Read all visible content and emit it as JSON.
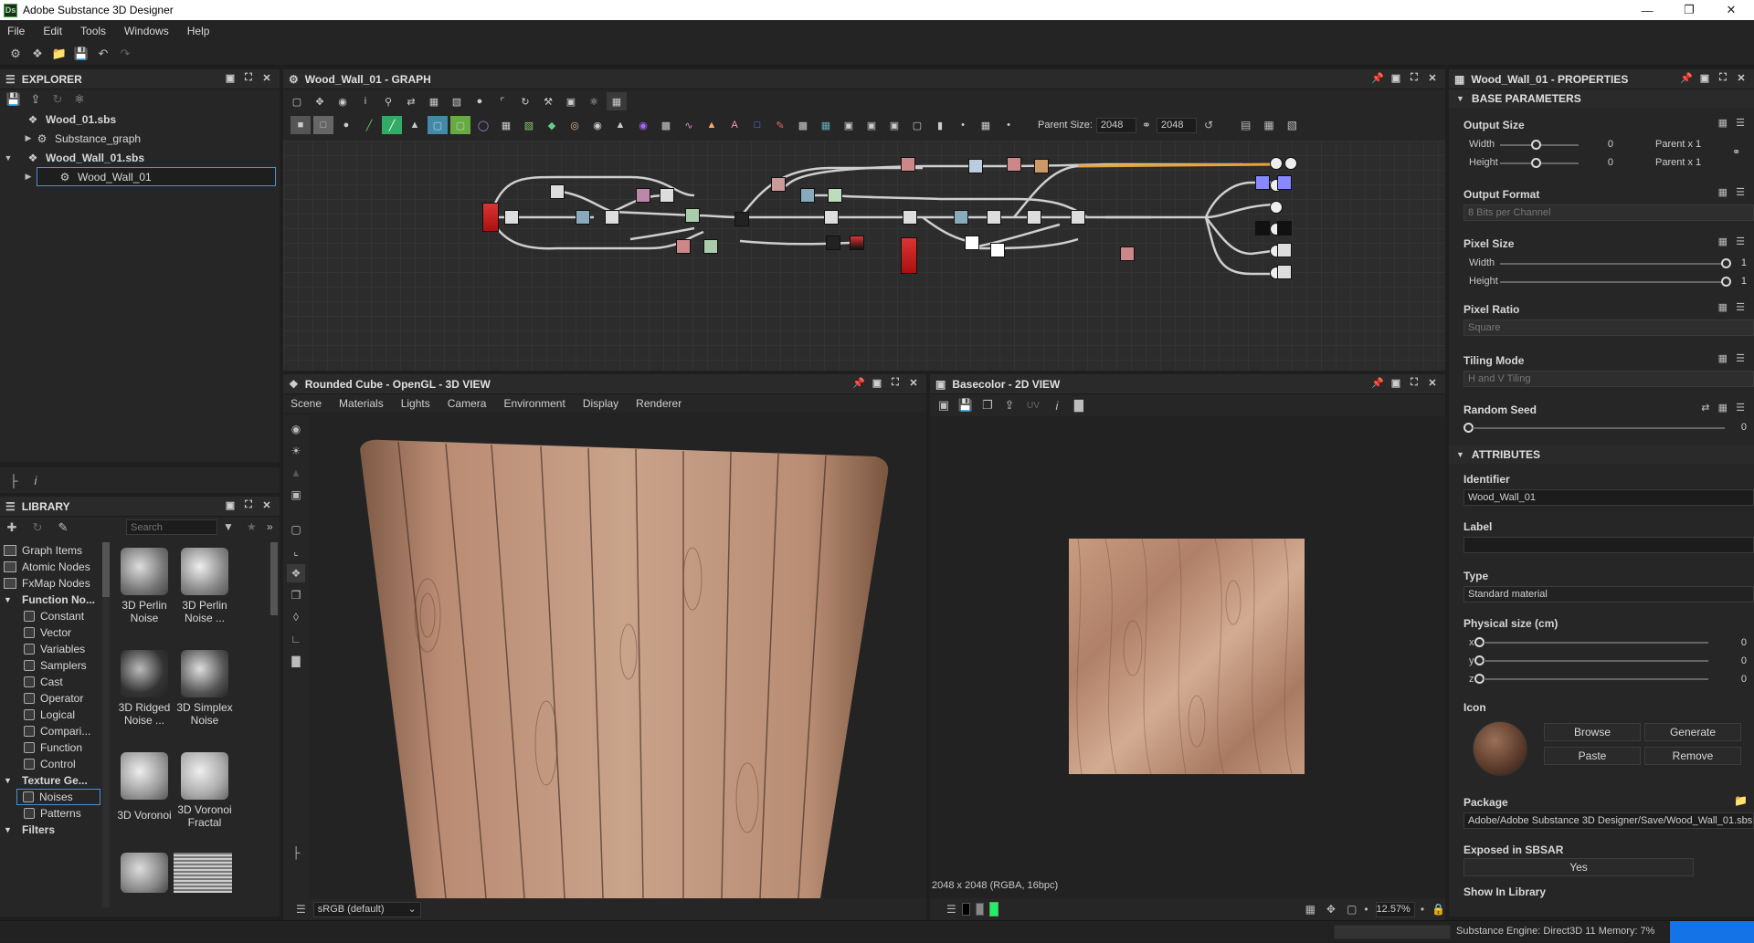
{
  "app": {
    "title": "Adobe Substance 3D Designer",
    "logo": "Ds"
  },
  "menu": [
    "File",
    "Edit",
    "Tools",
    "Windows",
    "Help"
  ],
  "explorer": {
    "title": "EXPLORER",
    "items": [
      {
        "label": "Wood_01.sbs"
      },
      {
        "label": "Substance_graph"
      },
      {
        "label": "Wood_Wall_01.sbs"
      },
      {
        "label": "Wood_Wall_01"
      }
    ]
  },
  "graph": {
    "title": "Wood_Wall_01 - GRAPH",
    "parent_size_label": "Parent Size:",
    "size1": "2048",
    "size2": "2048"
  },
  "library": {
    "title": "LIBRARY",
    "search_placeholder": "Search",
    "categories": [
      {
        "label": "Graph Items"
      },
      {
        "label": "Atomic Nodes"
      },
      {
        "label": "FxMap Nodes"
      },
      {
        "label": "Function No..."
      }
    ],
    "function_subs": [
      "Constant",
      "Vector",
      "Variables",
      "Samplers",
      "Cast",
      "Operator",
      "Logical",
      "Compari...",
      "Function",
      "Control"
    ],
    "texture_cat": "Texture Ge...",
    "texture_subs": [
      "Noises",
      "Patterns"
    ],
    "filters_cat": "Filters",
    "thumbs": [
      "3D Perlin Noise",
      "3D Perlin Noise ...",
      "3D Ridged Noise ...",
      "3D Simplex Noise",
      "3D Voronoi",
      "3D Voronoi Fractal"
    ]
  },
  "view3d": {
    "title": "Rounded Cube - OpenGL - 3D VIEW",
    "menu": [
      "Scene",
      "Materials",
      "Lights",
      "Camera",
      "Environment",
      "Display",
      "Renderer"
    ],
    "colorspace": "sRGB (default)"
  },
  "view2d": {
    "title": "Basecolor - 2D VIEW",
    "uv_label": "UV",
    "info": "2048 x 2048 (RGBA, 16bpc)",
    "zoom": "12.57%"
  },
  "properties": {
    "title": "Wood_Wall_01 - PROPERTIES",
    "base_section": "BASE PARAMETERS",
    "output_size": "Output Size",
    "width_label": "Width",
    "height_label": "Height",
    "output_width_val": "0",
    "output_height_val": "0",
    "output_width_rel": "Parent x 1",
    "output_height_rel": "Parent x 1",
    "output_format": "Output Format",
    "output_format_val": "8 Bits per Channel",
    "pixel_size": "Pixel Size",
    "pixel_width_val": "1",
    "pixel_height_val": "1",
    "pixel_ratio": "Pixel Ratio",
    "pixel_ratio_val": "Square",
    "tiling_mode": "Tiling Mode",
    "tiling_mode_val": "H and V Tiling",
    "random_seed": "Random Seed",
    "random_seed_val": "0",
    "attributes_section": "ATTRIBUTES",
    "identifier": "Identifier",
    "identifier_val": "Wood_Wall_01",
    "label": "Label",
    "type": "Type",
    "type_val": "Standard material",
    "physical_size": "Physical size (cm)",
    "px": "x",
    "py": "y",
    "pz": "z",
    "px_val": "0",
    "py_val": "0",
    "pz_val": "0",
    "icon": "Icon",
    "browse": "Browse",
    "generate": "Generate",
    "paste": "Paste",
    "remove": "Remove",
    "package": "Package",
    "package_val": "Adobe/Adobe Substance 3D Designer/Save/Wood_Wall_01.sbs",
    "exposed": "Exposed in SBSAR",
    "exposed_val": "Yes",
    "show_in_library": "Show In Library"
  },
  "status": {
    "engine": "Substance Engine: Direct3D 11  Memory: 7%"
  }
}
